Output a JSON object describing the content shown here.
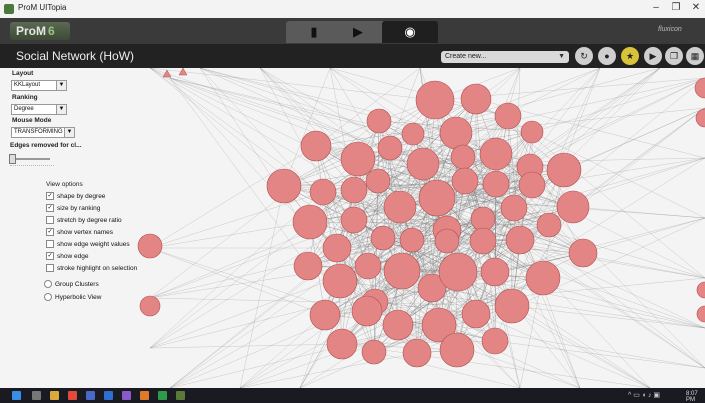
{
  "window": {
    "title": "ProM UITopia",
    "minimize_icon": "minimize-icon",
    "restore_icon": "restore-icon",
    "close_icon": "close-icon"
  },
  "header": {
    "logo_text": "ProM",
    "logo_version": "6",
    "tabs": [
      {
        "name": "workspace",
        "icon": "document-icon",
        "glyph": "▮"
      },
      {
        "name": "actions",
        "icon": "play-icon",
        "glyph": "▶"
      },
      {
        "name": "views",
        "icon": "eye-icon",
        "glyph": "◉"
      }
    ],
    "brand_text": "fluxicon"
  },
  "subheader": {
    "title": "Social Network (HoW)",
    "create_new": "Create new...",
    "buttons": [
      {
        "icon": "refresh-icon",
        "glyph": "↻"
      },
      {
        "icon": "drop-icon",
        "glyph": "●"
      },
      {
        "icon": "star-icon",
        "glyph": "★"
      },
      {
        "icon": "play-icon",
        "glyph": "▶"
      },
      {
        "icon": "copy-icon",
        "glyph": "❐"
      },
      {
        "icon": "grid-icon",
        "glyph": "▦"
      }
    ]
  },
  "panel": {
    "layout_label": "Layout",
    "layout_value": "KKLayout",
    "ranking_label": "Ranking",
    "ranking_value": "Degree",
    "mouse_mode_label": "Mouse Mode",
    "mouse_mode_value": "TRANSFORMING",
    "edges_removed_label": "Edges removed for cl...",
    "view_options_label": "View options",
    "options": [
      {
        "label": "shape by degree",
        "checked": true
      },
      {
        "label": "size by ranking",
        "checked": true
      },
      {
        "label": "stretch by degree ratio",
        "checked": false
      },
      {
        "label": "show vertex names",
        "checked": true
      },
      {
        "label": "show edge weight values",
        "checked": false
      },
      {
        "label": "show edge",
        "checked": true
      },
      {
        "label": "stroke highlight on selection",
        "checked": false
      }
    ],
    "radios": [
      {
        "label": "Group Clusters"
      },
      {
        "label": "Hyperbolic View"
      }
    ]
  },
  "graph": {
    "node_color": "#e48585",
    "node_stroke": "#b05050",
    "edge_color": "#7a7a7a"
  },
  "taskbar": {
    "clock": "8:07 PM"
  },
  "colors": {
    "header_bg": "#3a3a3a",
    "subheader_bg": "#222222",
    "canvas_bg": "#f4f4f4"
  }
}
